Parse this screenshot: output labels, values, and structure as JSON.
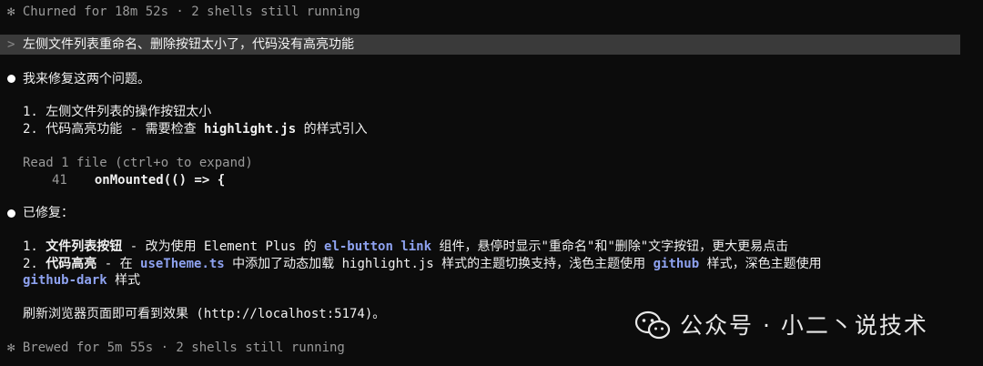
{
  "status": {
    "churned": "✻ Churned for 18m 52s · 2 shells still running",
    "brewed": "✻ Brewed for 5m 55s · 2 shells still running"
  },
  "prompt": {
    "caret": ">",
    "text": "左侧文件列表重命名、删除按钮太小了，代码没有高亮功能"
  },
  "reply1": {
    "intro": "我来修复这两个问题。",
    "item1": "1. 左侧文件列表的操作按钮太小",
    "item2_prefix": "2. 代码高亮功能 - 需要检查 ",
    "item2_code": "highlight.js",
    "item2_suffix": " 的样式引入"
  },
  "read": {
    "summary": "Read 1 file (ctrl+o to expand)",
    "line_no": "41",
    "line_code": "onMounted(() => {"
  },
  "reply2": {
    "intro": "已修复：",
    "i1_num": "1. ",
    "i1_title": "文件列表按钮",
    "i1_a": " - 改为使用 Element Plus 的 ",
    "i1_code": "el-button link",
    "i1_b": " 组件，悬停时显示\"重命名\"和\"删除\"文字按钮，更大更易点击",
    "i2_num": "2. ",
    "i2_title": "代码高亮",
    "i2_a": " - 在 ",
    "i2_code1": "useTheme.ts",
    "i2_b": " 中添加了动态加载 highlight.js 样式的主题切换支持，浅色主题使用 ",
    "i2_code2": "github",
    "i2_c": " 样式，深色主题使用",
    "i2_code3": "github-dark",
    "i2_d": " 样式",
    "refresh": "刷新浏览器页面即可看到效果 (http://localhost:5174)。"
  },
  "watermark": {
    "icon": "wechat-icon",
    "text": "公众号 · 小二丶说技术"
  }
}
